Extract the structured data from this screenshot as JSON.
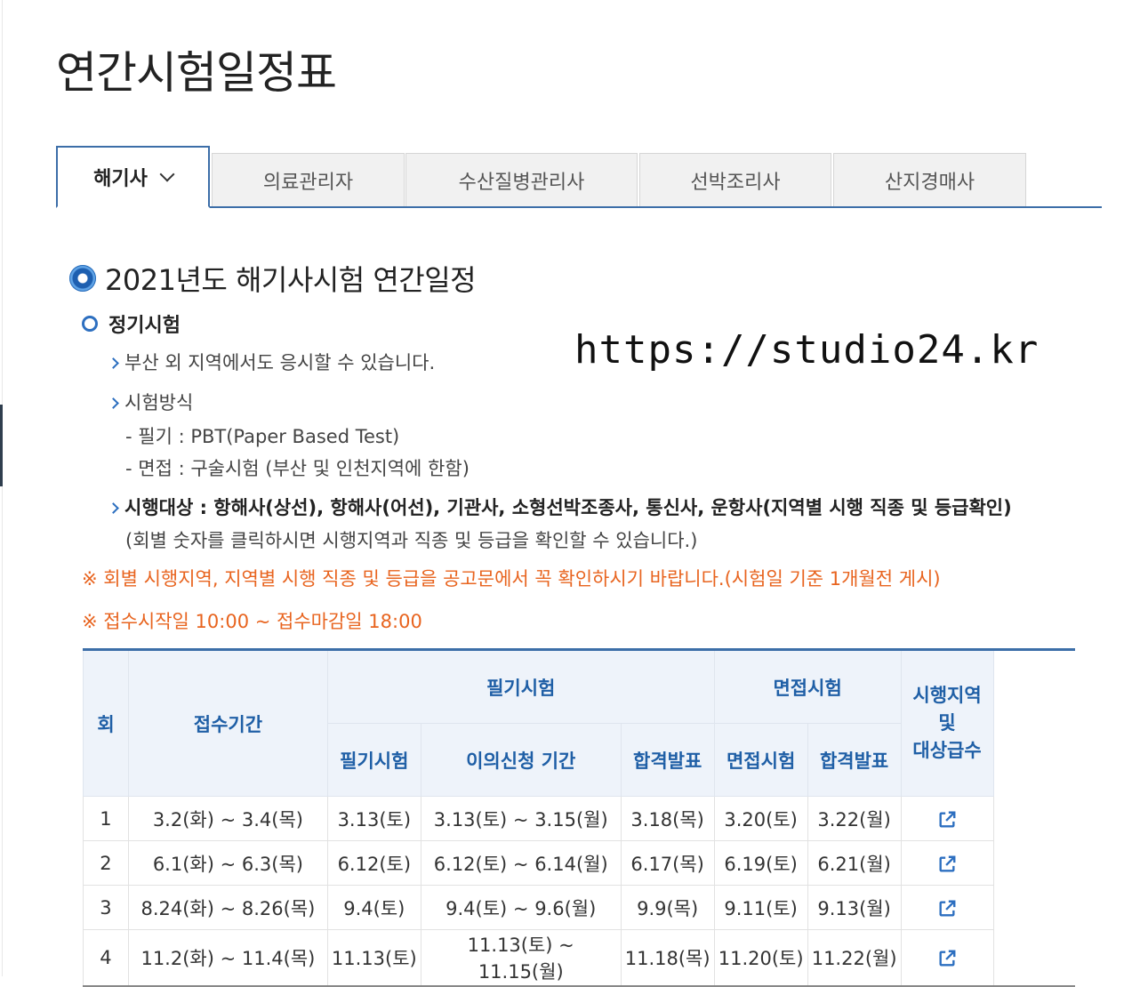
{
  "page_title": "연간시험일정표",
  "tabs": [
    {
      "label": "해기사",
      "active": true
    },
    {
      "label": "의료관리자"
    },
    {
      "label": "수산질병관리사"
    },
    {
      "label": "선박조리사"
    },
    {
      "label": "산지경매사"
    }
  ],
  "section_title": "2021년도 해기사시험 연간일정",
  "subsection_title": "정기시험",
  "watermark": "https://studio24.kr",
  "lines": {
    "l1": "부산 외 지역에서도 응시할 수 있습니다.",
    "l2": "시험방식",
    "l3": "- 필기 : PBT(Paper Based Test)",
    "l4": "- 면접 : 구술시험 (부산 및 인천지역에 한함)",
    "l5": "시행대상 : 항해사(상선), 항해사(어선), 기관사, 소형선박조종사, 통신사, 운항사(지역별 시행 직종 및 등급확인)",
    "l6": "(회별 숫자를 클릭하시면 시행지역과 직종 및 등급을 확인할 수 있습니다.)",
    "warn1": "※ 회별 시행지역, 지역별 시행 직종 및 등급을 공고문에서 꼭 확인하시기 바랍니다.(시험일 기준 1개월전 게시)",
    "warn2": "※ 접수시작일 10:00 ~ 접수마감일 18:00"
  },
  "table": {
    "h_round": "회",
    "h_period": "접수기간",
    "h_written": "필기시험",
    "h_interview": "면접시험",
    "h_region": "시행지역\n및\n대상급수",
    "h_written_exam": "필기시험",
    "h_objection": "이의신청 기간",
    "h_written_result": "합격발표",
    "h_interview_exam": "면접시험",
    "h_interview_result": "합격발표",
    "rows": [
      {
        "round": "1",
        "period": "3.2(화) ~ 3.4(목)",
        "written": "3.13(토)",
        "objection": "3.13(토) ~ 3.15(월)",
        "written_result": "3.18(목)",
        "interview": "3.20(토)",
        "interview_result": "3.22(월)"
      },
      {
        "round": "2",
        "period": "6.1(화) ~ 6.3(목)",
        "written": "6.12(토)",
        "objection": "6.12(토) ~ 6.14(월)",
        "written_result": "6.17(목)",
        "interview": "6.19(토)",
        "interview_result": "6.21(월)"
      },
      {
        "round": "3",
        "period": "8.24(화) ~ 8.26(목)",
        "written": "9.4(토)",
        "objection": "9.4(토) ~ 9.6(월)",
        "written_result": "9.9(목)",
        "interview": "9.11(토)",
        "interview_result": "9.13(월)"
      },
      {
        "round": "4",
        "period": "11.2(화) ~ 11.4(목)",
        "written": "11.13(토)",
        "objection": "11.13(토) ~ 11.15(월)",
        "written_result": "11.18(목)",
        "interview": "11.20(토)",
        "interview_result": "11.22(월)"
      }
    ]
  },
  "colors": {
    "accent": "#3c6ea8",
    "header_bg": "#eef3fa",
    "warn": "#e8641f"
  },
  "icons": {
    "region_link": "external-link-icon"
  }
}
